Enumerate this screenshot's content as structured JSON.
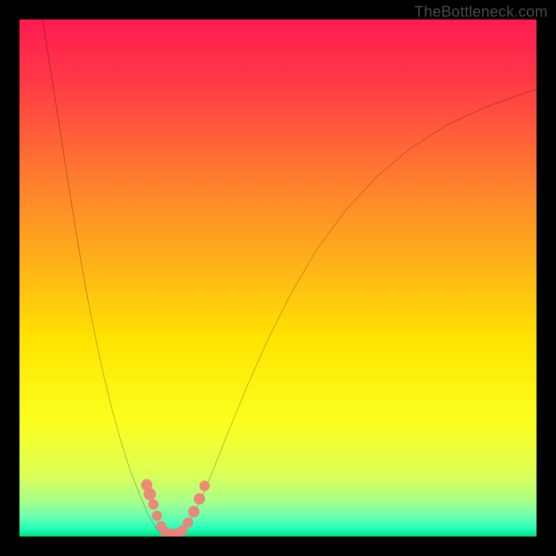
{
  "watermark": "TheBottleneck.com",
  "chart_data": {
    "type": "line",
    "title": "",
    "xlabel": "",
    "ylabel": "",
    "xlim": [
      0,
      100
    ],
    "ylim": [
      0,
      100
    ],
    "gradient_stops": [
      {
        "offset": 0.0,
        "color": "#ff1b50"
      },
      {
        "offset": 0.12,
        "color": "#ff3946"
      },
      {
        "offset": 0.3,
        "color": "#ff7a2f"
      },
      {
        "offset": 0.48,
        "color": "#ffb417"
      },
      {
        "offset": 0.62,
        "color": "#ffe400"
      },
      {
        "offset": 0.78,
        "color": "#fbff1f"
      },
      {
        "offset": 0.88,
        "color": "#dcff55"
      },
      {
        "offset": 0.93,
        "color": "#aaff88"
      },
      {
        "offset": 0.965,
        "color": "#66ffb3"
      },
      {
        "offset": 0.985,
        "color": "#1fffb8"
      },
      {
        "offset": 1.0,
        "color": "#00e07f"
      }
    ],
    "series": [
      {
        "name": "left-branch",
        "points": [
          {
            "x": 4.5,
            "y": 100.0
          },
          {
            "x": 5.5,
            "y": 93.5
          },
          {
            "x": 6.6,
            "y": 86.5
          },
          {
            "x": 7.8,
            "y": 79.0
          },
          {
            "x": 9.0,
            "y": 71.0
          },
          {
            "x": 10.3,
            "y": 63.0
          },
          {
            "x": 11.6,
            "y": 55.0
          },
          {
            "x": 13.0,
            "y": 47.0
          },
          {
            "x": 14.5,
            "y": 39.5
          },
          {
            "x": 16.1,
            "y": 32.0
          },
          {
            "x": 17.8,
            "y": 25.0
          },
          {
            "x": 19.6,
            "y": 18.5
          },
          {
            "x": 21.5,
            "y": 12.5
          },
          {
            "x": 23.5,
            "y": 7.5
          },
          {
            "x": 25.0,
            "y": 4.0
          },
          {
            "x": 26.5,
            "y": 1.5
          },
          {
            "x": 27.5,
            "y": 0.3
          },
          {
            "x": 28.5,
            "y": 0.0
          }
        ]
      },
      {
        "name": "right-branch",
        "points": [
          {
            "x": 28.5,
            "y": 0.0
          },
          {
            "x": 30.0,
            "y": 0.2
          },
          {
            "x": 31.5,
            "y": 1.0
          },
          {
            "x": 33.0,
            "y": 3.0
          },
          {
            "x": 35.0,
            "y": 7.0
          },
          {
            "x": 37.5,
            "y": 13.0
          },
          {
            "x": 40.5,
            "y": 20.5
          },
          {
            "x": 44.0,
            "y": 29.0
          },
          {
            "x": 48.0,
            "y": 38.0
          },
          {
            "x": 52.5,
            "y": 47.0
          },
          {
            "x": 57.5,
            "y": 55.5
          },
          {
            "x": 63.0,
            "y": 63.0
          },
          {
            "x": 69.0,
            "y": 69.5
          },
          {
            "x": 75.5,
            "y": 75.0
          },
          {
            "x": 82.5,
            "y": 79.5
          },
          {
            "x": 90.0,
            "y": 83.0
          },
          {
            "x": 97.0,
            "y": 85.5
          },
          {
            "x": 100.0,
            "y": 86.5
          }
        ]
      }
    ],
    "markers": [
      {
        "x": 24.6,
        "y": 10.0,
        "r": 1.1
      },
      {
        "x": 25.2,
        "y": 8.2,
        "r": 1.2
      },
      {
        "x": 25.9,
        "y": 6.2,
        "r": 1.0
      },
      {
        "x": 26.6,
        "y": 4.0,
        "r": 1.0
      },
      {
        "x": 27.4,
        "y": 2.0,
        "r": 1.0
      },
      {
        "x": 28.3,
        "y": 0.7,
        "r": 1.1
      },
      {
        "x": 29.4,
        "y": 0.3,
        "r": 1.2
      },
      {
        "x": 30.5,
        "y": 0.5,
        "r": 1.1
      },
      {
        "x": 31.5,
        "y": 1.2,
        "r": 1.0
      },
      {
        "x": 32.6,
        "y": 2.7,
        "r": 1.0
      },
      {
        "x": 33.7,
        "y": 4.8,
        "r": 1.1
      },
      {
        "x": 34.8,
        "y": 7.3,
        "r": 1.1
      },
      {
        "x": 35.8,
        "y": 9.8,
        "r": 1.0
      }
    ],
    "marker_color": "#f08078"
  }
}
